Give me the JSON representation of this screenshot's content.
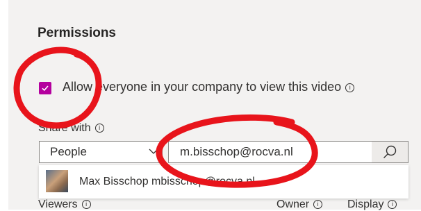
{
  "permissions": {
    "title": "Permissions",
    "allow_everyone_label": "Allow everyone in your company to view this video",
    "allow_everyone_checked": true,
    "share_with_label": "Share with",
    "share_type_selected": "People",
    "search_value": "m.bisschop@rocva.nl",
    "suggestion": {
      "name": "Max Bisschop",
      "email": "mbisschop@rocva.nl"
    },
    "columns": {
      "viewers": "Viewers",
      "owner": "Owner",
      "display": "Display"
    }
  },
  "colors": {
    "accent": "#b4009e",
    "annotation": "#e8141b"
  },
  "icons": [
    "info-icon",
    "chevron-down-icon",
    "search-icon",
    "checkmark-icon"
  ]
}
